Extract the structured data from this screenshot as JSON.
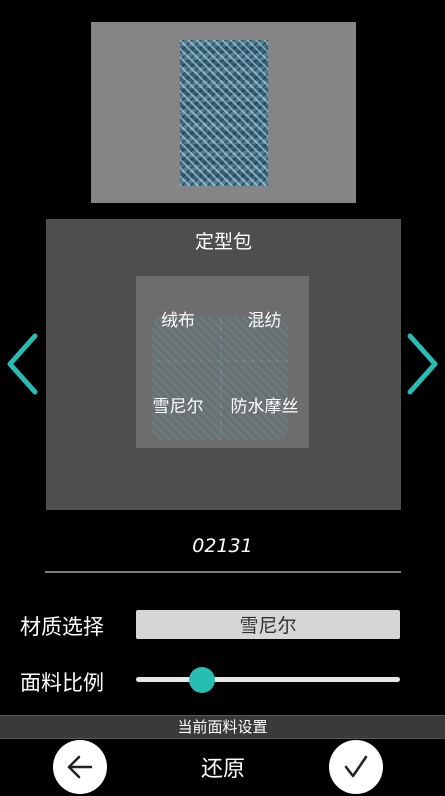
{
  "panel": {
    "title": "定型包"
  },
  "materials": [
    {
      "label": "绒布"
    },
    {
      "label": "混纺"
    },
    {
      "label": "雪尼尔"
    },
    {
      "label": "防水摩丝"
    }
  ],
  "fabric_code": "02131",
  "material_select": {
    "label": "材质选择",
    "value": "雪尼尔"
  },
  "fabric_ratio": {
    "label": "面料比例",
    "value": 0.25
  },
  "settings_bar": {
    "label": "当前面料设置"
  },
  "bottom": {
    "restore_label": "还原"
  },
  "icons": {
    "prev": "chevron-left-icon",
    "next": "chevron-right-icon",
    "back": "arrow-left-icon",
    "confirm": "checkmark-icon"
  },
  "colors": {
    "accent": "#27bcb4",
    "panel": "#4e4e4e",
    "preview": "#858585"
  }
}
